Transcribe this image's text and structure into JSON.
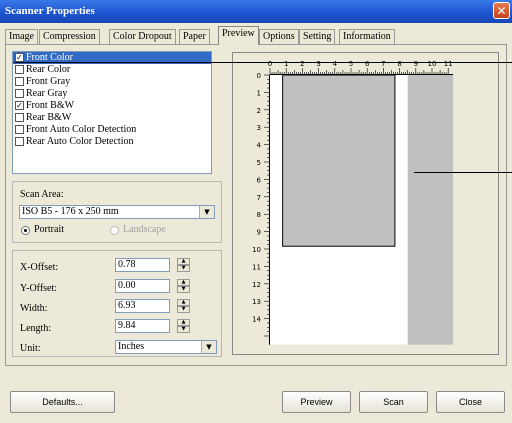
{
  "window": {
    "title": "Scanner Properties",
    "close_glyph": "✕"
  },
  "tabs": [
    {
      "label": "Image",
      "active": false
    },
    {
      "label": "Compression",
      "active": false
    },
    {
      "label": "Color Dropout",
      "active": false
    },
    {
      "label": "Paper",
      "active": false
    },
    {
      "label": "Preview",
      "active": true
    },
    {
      "label": "Options",
      "active": false
    },
    {
      "label": "Setting",
      "active": false
    },
    {
      "label": "Information",
      "active": false
    }
  ],
  "image_list": [
    {
      "label": "Front Color",
      "checked": true,
      "selected": true
    },
    {
      "label": "Rear Color",
      "checked": false,
      "selected": false
    },
    {
      "label": "Front Gray",
      "checked": false,
      "selected": false
    },
    {
      "label": "Rear Gray",
      "checked": false,
      "selected": false
    },
    {
      "label": "Front B&W",
      "checked": true,
      "selected": false
    },
    {
      "label": "Rear B&W",
      "checked": false,
      "selected": false
    },
    {
      "label": "Front Auto Color Detection",
      "checked": false,
      "selected": false
    },
    {
      "label": "Rear Auto Color Detection",
      "checked": false,
      "selected": false
    }
  ],
  "scan_area": {
    "label": "Scan Area:",
    "value": "ISO B5 - 176 x 250 mm",
    "portrait_label": "Portrait",
    "landscape_label": "Landscape",
    "orientation": "portrait"
  },
  "offsets": {
    "x_offset": {
      "label": "X-Offset:",
      "value": "0.78"
    },
    "y_offset": {
      "label": "Y-Offset:",
      "value": "0.00"
    },
    "width": {
      "label": "Width:",
      "value": "6.93"
    },
    "length": {
      "label": "Length:",
      "value": "9.84"
    },
    "unit": {
      "label": "Unit:",
      "value": "Inches"
    }
  },
  "preview": {
    "ruler_top": [
      "0",
      "1",
      "2",
      "3",
      "4",
      "5",
      "6",
      "7",
      "8",
      "9",
      "10",
      "11"
    ],
    "ruler_left": [
      "0",
      "1",
      "2",
      "3",
      "4",
      "5",
      "6",
      "7",
      "8",
      "9",
      "10",
      "11",
      "12",
      "13",
      "14"
    ],
    "paper_width_in": 8.5,
    "scan_x_in": 0.78,
    "scan_y_in": 0.0,
    "scan_w_in": 6.93,
    "scan_l_in": 9.84,
    "colors": {
      "paper": "#ffffff",
      "bed": "#c0c0c0"
    }
  },
  "buttons": {
    "defaults": "Defaults...",
    "preview": "Preview",
    "scan": "Scan",
    "close": "Close"
  }
}
